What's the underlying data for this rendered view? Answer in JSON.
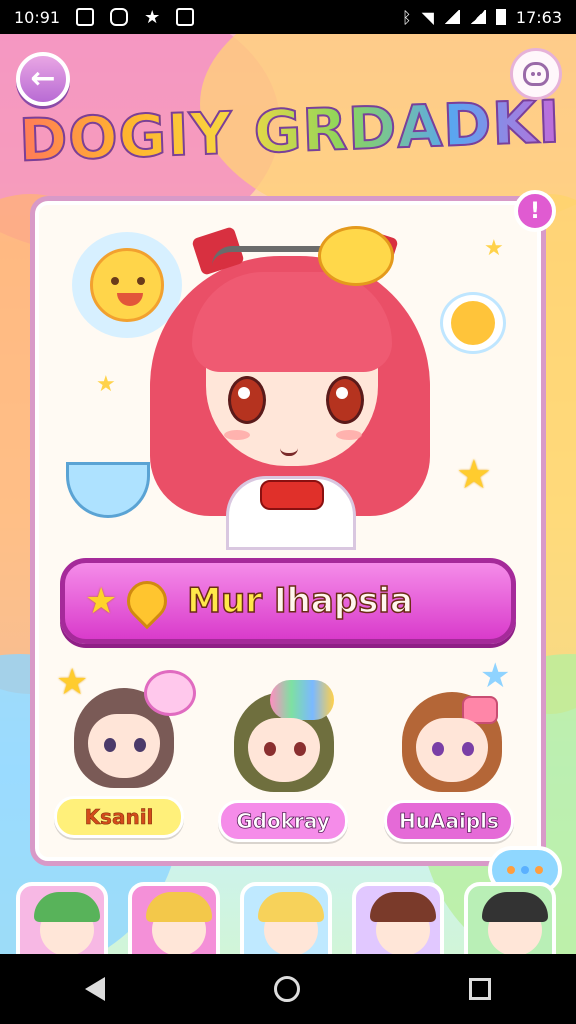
{
  "status_bar": {
    "time": "10:91",
    "right_time": "17:63",
    "icons": [
      "image-icon",
      "message-icon",
      "star-icon",
      "gallery-icon",
      "bluetooth-icon",
      "wifi-icon",
      "signal-icon",
      "battery-icon"
    ]
  },
  "header": {
    "title": "DOGIY GRDADKI",
    "back_icon": "back-arrow-icon",
    "profile_icon": "robot-face-icon"
  },
  "card": {
    "info_label": "!",
    "character_name_part1": "Mur",
    "character_name_part2": "Ihapsia"
  },
  "friends": [
    {
      "name": "Ksanil"
    },
    {
      "name": "Gdokray"
    },
    {
      "name": "HuAaipls"
    }
  ],
  "tray": {
    "items": [
      {
        "icon": "character-1-icon",
        "color": "#f7b8e4"
      },
      {
        "icon": "character-2-icon",
        "color": "#f490d8"
      },
      {
        "icon": "character-3-icon",
        "color": "#bfe9ff"
      },
      {
        "icon": "character-4-icon",
        "color": "#e1c8ff"
      },
      {
        "icon": "character-5-icon",
        "color": "#b9efb6"
      }
    ]
  },
  "colors": {
    "accent_pink": "#e05bd1",
    "card_border": "#d89ac8",
    "banner_gold": "#ffe84a"
  },
  "nav": {
    "icons": [
      "nav-back-icon",
      "nav-home-icon",
      "nav-recents-icon"
    ]
  }
}
